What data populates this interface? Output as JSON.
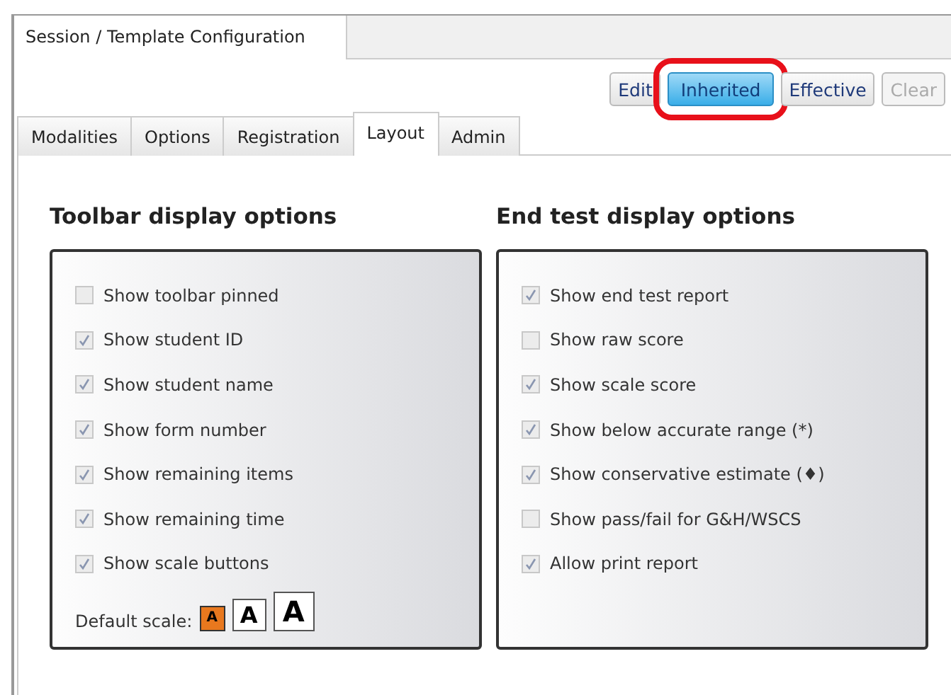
{
  "window": {
    "title": "Session / Template Configuration"
  },
  "buttons": [
    {
      "label": "Edit",
      "selected": false,
      "disabled": false,
      "highlighted": false
    },
    {
      "label": "Inherited",
      "selected": true,
      "disabled": false,
      "highlighted": true
    },
    {
      "label": "Effective",
      "selected": false,
      "disabled": false,
      "highlighted": false
    },
    {
      "label": "Clear",
      "selected": false,
      "disabled": true,
      "highlighted": false
    }
  ],
  "tabs": [
    {
      "label": "Modalities",
      "selected": false
    },
    {
      "label": "Options",
      "selected": false
    },
    {
      "label": "Registration",
      "selected": false
    },
    {
      "label": "Layout",
      "selected": true
    },
    {
      "label": "Admin",
      "selected": false
    }
  ],
  "sections": [
    {
      "title": "Toolbar display options",
      "options": [
        {
          "label": "Show toolbar pinned",
          "checked": false
        },
        {
          "label": "Show student ID",
          "checked": true
        },
        {
          "label": "Show student name",
          "checked": true
        },
        {
          "label": "Show form number",
          "checked": true
        },
        {
          "label": "Show remaining items",
          "checked": true
        },
        {
          "label": "Show remaining time",
          "checked": true
        },
        {
          "label": "Show scale buttons",
          "checked": true
        }
      ],
      "default_scale": {
        "label": "Default scale:",
        "scales": [
          {
            "label": "A",
            "selected": true
          },
          {
            "label": "A",
            "selected": false
          },
          {
            "label": "A",
            "selected": false
          }
        ]
      }
    },
    {
      "title": "End test display options",
      "options": [
        {
          "label": "Show end test report",
          "checked": true
        },
        {
          "label": "Show raw score",
          "checked": false
        },
        {
          "label": "Show scale score",
          "checked": true
        },
        {
          "label": "Show below accurate range (*)",
          "checked": true
        },
        {
          "label": "Show conservative estimate (♦)",
          "checked": true
        },
        {
          "label": "Show pass/fail for G&H/WSCS",
          "checked": false
        },
        {
          "label": "Allow print report",
          "checked": true
        }
      ]
    }
  ]
}
